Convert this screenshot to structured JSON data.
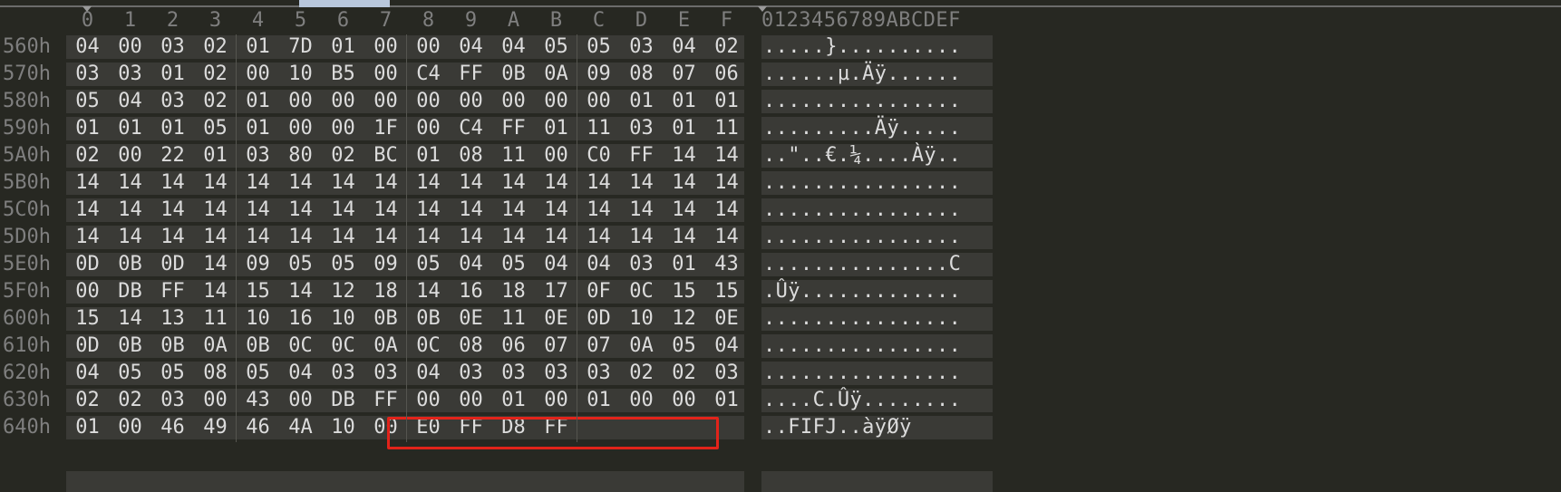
{
  "column_headers": [
    "0",
    "1",
    "2",
    "3",
    "4",
    "5",
    "6",
    "7",
    "8",
    "9",
    "A",
    "B",
    "C",
    "D",
    "E",
    "F"
  ],
  "ascii_header": "0123456789ABCDEF",
  "rows": [
    {
      "offset": "560h",
      "bytes": [
        "04",
        "00",
        "03",
        "02",
        "01",
        "7D",
        "01",
        "00",
        "00",
        "04",
        "04",
        "05",
        "05",
        "03",
        "04",
        "02"
      ],
      "ascii": ".....}.........."
    },
    {
      "offset": "570h",
      "bytes": [
        "03",
        "03",
        "01",
        "02",
        "00",
        "10",
        "B5",
        "00",
        "C4",
        "FF",
        "0B",
        "0A",
        "09",
        "08",
        "07",
        "06"
      ],
      "ascii": "......µ.Äÿ......"
    },
    {
      "offset": "580h",
      "bytes": [
        "05",
        "04",
        "03",
        "02",
        "01",
        "00",
        "00",
        "00",
        "00",
        "00",
        "00",
        "00",
        "00",
        "01",
        "01",
        "01"
      ],
      "ascii": "................"
    },
    {
      "offset": "590h",
      "bytes": [
        "01",
        "01",
        "01",
        "05",
        "01",
        "00",
        "00",
        "1F",
        "00",
        "C4",
        "FF",
        "01",
        "11",
        "03",
        "01",
        "11"
      ],
      "ascii": ".........Äÿ....."
    },
    {
      "offset": "5A0h",
      "bytes": [
        "02",
        "00",
        "22",
        "01",
        "03",
        "80",
        "02",
        "BC",
        "01",
        "08",
        "11",
        "00",
        "C0",
        "FF",
        "14",
        "14"
      ],
      "ascii": "..\"..€.¼....Àÿ.."
    },
    {
      "offset": "5B0h",
      "bytes": [
        "14",
        "14",
        "14",
        "14",
        "14",
        "14",
        "14",
        "14",
        "14",
        "14",
        "14",
        "14",
        "14",
        "14",
        "14",
        "14"
      ],
      "ascii": "................"
    },
    {
      "offset": "5C0h",
      "bytes": [
        "14",
        "14",
        "14",
        "14",
        "14",
        "14",
        "14",
        "14",
        "14",
        "14",
        "14",
        "14",
        "14",
        "14",
        "14",
        "14"
      ],
      "ascii": "................"
    },
    {
      "offset": "5D0h",
      "bytes": [
        "14",
        "14",
        "14",
        "14",
        "14",
        "14",
        "14",
        "14",
        "14",
        "14",
        "14",
        "14",
        "14",
        "14",
        "14",
        "14"
      ],
      "ascii": "................"
    },
    {
      "offset": "5E0h",
      "bytes": [
        "0D",
        "0B",
        "0D",
        "14",
        "09",
        "05",
        "05",
        "09",
        "05",
        "04",
        "05",
        "04",
        "04",
        "03",
        "01",
        "43"
      ],
      "ascii": "...............C"
    },
    {
      "offset": "5F0h",
      "bytes": [
        "00",
        "DB",
        "FF",
        "14",
        "15",
        "14",
        "12",
        "18",
        "14",
        "16",
        "18",
        "17",
        "0F",
        "0C",
        "15",
        "15"
      ],
      "ascii": ".Ûÿ............."
    },
    {
      "offset": "600h",
      "bytes": [
        "15",
        "14",
        "13",
        "11",
        "10",
        "16",
        "10",
        "0B",
        "0B",
        "0E",
        "11",
        "0E",
        "0D",
        "10",
        "12",
        "0E"
      ],
      "ascii": "................"
    },
    {
      "offset": "610h",
      "bytes": [
        "0D",
        "0B",
        "0B",
        "0A",
        "0B",
        "0C",
        "0C",
        "0A",
        "0C",
        "08",
        "06",
        "07",
        "07",
        "0A",
        "05",
        "04"
      ],
      "ascii": "................"
    },
    {
      "offset": "620h",
      "bytes": [
        "04",
        "05",
        "05",
        "08",
        "05",
        "04",
        "03",
        "03",
        "04",
        "03",
        "03",
        "03",
        "03",
        "02",
        "02",
        "03"
      ],
      "ascii": "................"
    },
    {
      "offset": "630h",
      "bytes": [
        "02",
        "02",
        "03",
        "00",
        "43",
        "00",
        "DB",
        "FF",
        "00",
        "00",
        "01",
        "00",
        "01",
        "00",
        "00",
        "01"
      ],
      "ascii": "....C.Ûÿ........"
    },
    {
      "offset": "640h",
      "bytes": [
        "01",
        "00",
        "46",
        "49",
        "46",
        "4A",
        "10",
        "00",
        "E0",
        "FF",
        "D8",
        "FF"
      ],
      "ascii": "..FIFJ..àÿØÿ"
    }
  ],
  "colors": {
    "background": "#272822",
    "row_shade": "#3a3a36",
    "selection_outline": "#e2231a",
    "scrollbar_thumb": "#b8c7dc"
  }
}
